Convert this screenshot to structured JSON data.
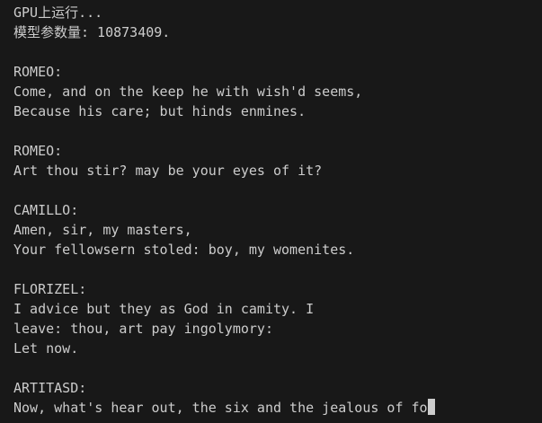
{
  "terminal": {
    "lines": [
      "GPU上运行...",
      "模型参数量: 10873409.",
      "",
      "ROMEO:",
      "Come, and on the keep he with wish'd seems,",
      "Because his care; but hinds enmines.",
      "",
      "ROMEO:",
      "Art thou stir? may be your eyes of it?",
      "",
      "CAMILLO:",
      "Amen, sir, my masters,",
      "Your fellowsern stoled: boy, my womenites.",
      "",
      "FLORIZEL:",
      "I advice but they as God in camity. I",
      "leave: thou, art pay ingolymory:",
      "Let now.",
      "",
      "ARTITASD:",
      "Now, what's hear out, the six and the jealous of fo"
    ]
  },
  "colors": {
    "background": "#181818",
    "text": "#cccccc",
    "cursor": "#cccccc"
  }
}
